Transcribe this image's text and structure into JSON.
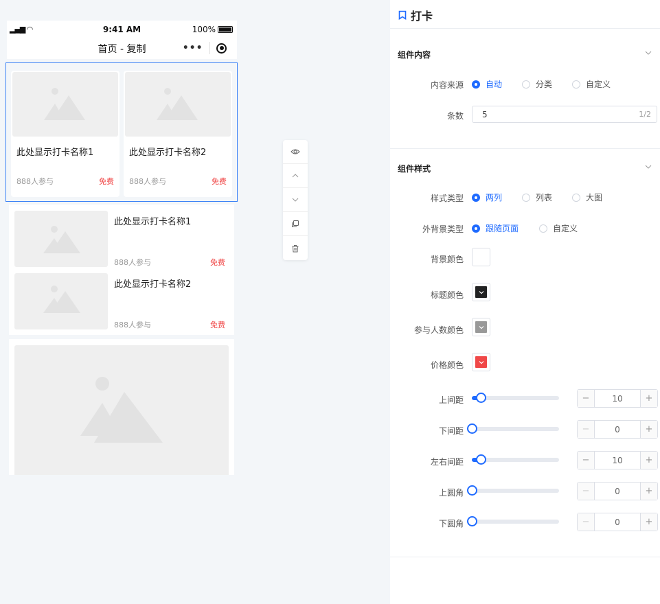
{
  "phone": {
    "status": {
      "time": "9:41 AM",
      "battery": "100%"
    },
    "nav": {
      "title": "首页 - 复制"
    },
    "grid_cards": [
      {
        "name": "此处显示打卡名称1",
        "join": "888人参与",
        "price": "免费"
      },
      {
        "name": "此处显示打卡名称2",
        "join": "888人参与",
        "price": "免费"
      }
    ],
    "list_cards": [
      {
        "name": "此处显示打卡名称1",
        "join": "888人参与",
        "price": "免费"
      },
      {
        "name": "此处显示打卡名称2",
        "join": "888人参与",
        "price": "免费"
      }
    ]
  },
  "toolbar": {
    "icons": [
      "eye-icon",
      "chevron-up-icon",
      "chevron-down-icon",
      "copy-icon",
      "trash-icon"
    ]
  },
  "panel": {
    "title": "打卡",
    "content_section": {
      "heading": "组件内容",
      "source_label": "内容来源",
      "source_options": [
        "自动",
        "分类",
        "自定义"
      ],
      "source_selected": "自动",
      "count_label": "条数",
      "count_value": "5",
      "count_counter": "1/2"
    },
    "style_section": {
      "heading": "组件样式",
      "style_type_label": "样式类型",
      "style_type_options": [
        "两列",
        "列表",
        "大图"
      ],
      "style_type_selected": "两列",
      "bg_type_label": "外背景类型",
      "bg_type_options": [
        "跟随页面",
        "自定义"
      ],
      "bg_type_selected": "跟随页面",
      "bg_color_label": "背景颜色",
      "title_color_label": "标题颜色",
      "join_color_label": "参与人数颜色",
      "price_color_label": "价格颜色",
      "colors": {
        "bg": "#ffffff",
        "title": "#222222",
        "join": "#999999",
        "price": "#f04848"
      },
      "spacing": [
        {
          "label": "上间距",
          "value": "10",
          "max": 100
        },
        {
          "label": "下间距",
          "value": "0",
          "max": 100
        },
        {
          "label": "左右间距",
          "value": "10",
          "max": 100
        },
        {
          "label": "上圆角",
          "value": "0",
          "max": 100
        },
        {
          "label": "下圆角",
          "value": "0",
          "max": 100
        }
      ]
    },
    "accent": "#1f6bff"
  }
}
